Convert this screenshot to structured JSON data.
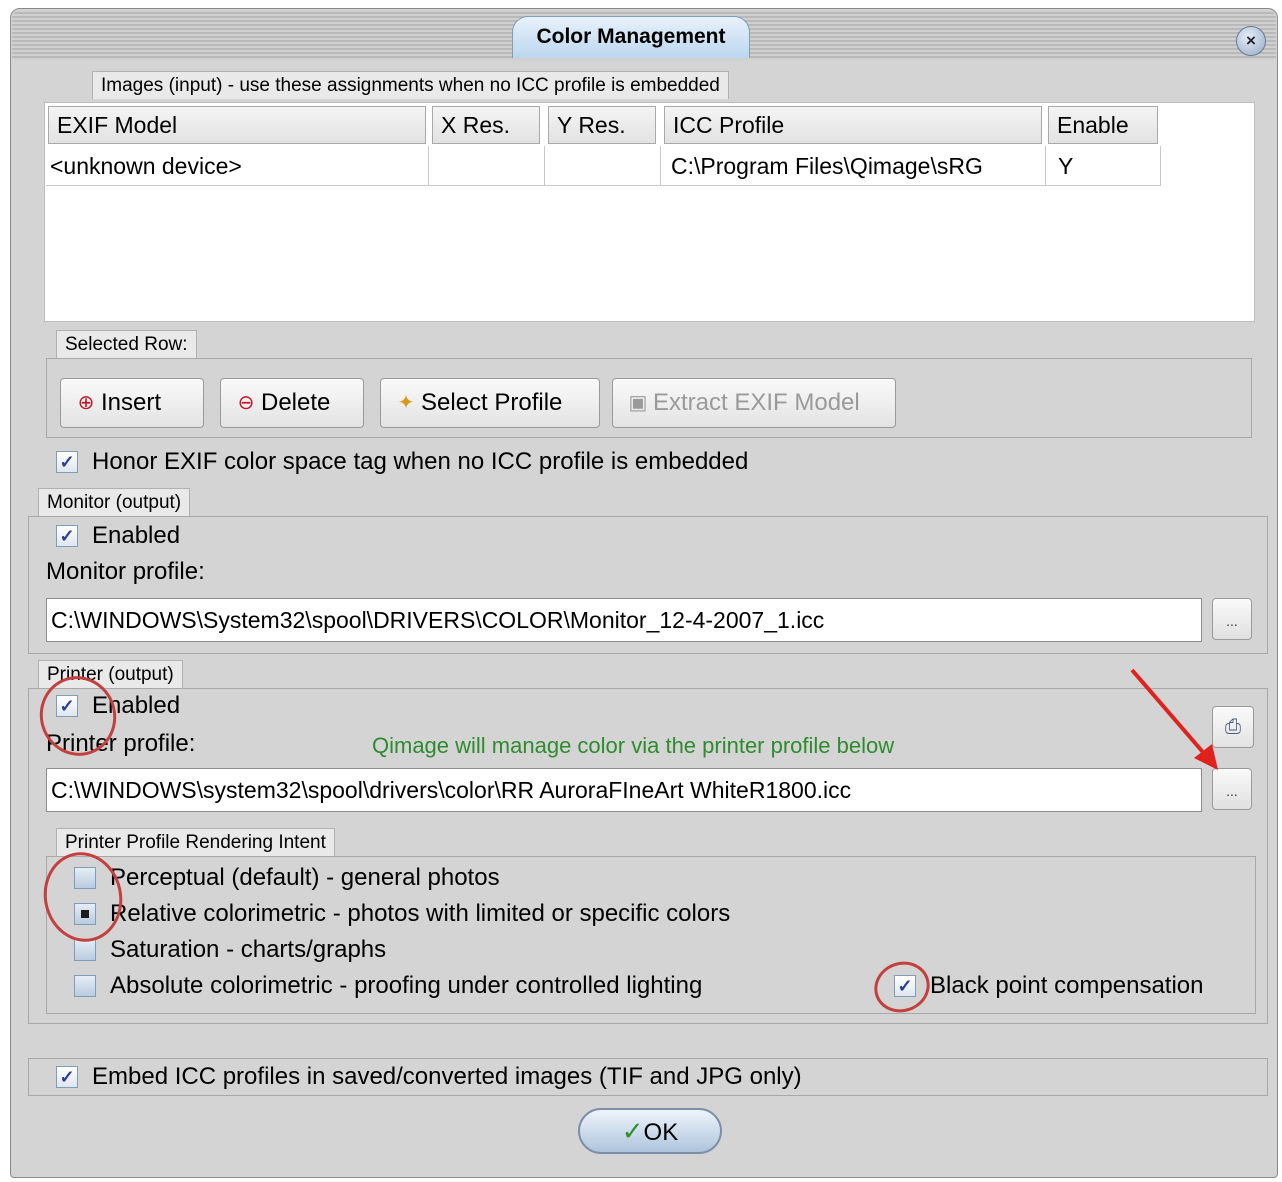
{
  "window": {
    "title": "Color Management",
    "close_glyph": "×"
  },
  "images_section": {
    "header": "Images (input) - use these assignments when no ICC profile is embedded",
    "columns": [
      "EXIF Model",
      "X Res.",
      "Y Res.",
      "ICC Profile",
      "Enable"
    ],
    "rows": [
      [
        "<unknown device>",
        "",
        "",
        "C:\\Program Files\\Qimage\\sRG",
        "Y"
      ]
    ],
    "selected_row_label": "Selected Row:",
    "buttons": {
      "insert": "Insert",
      "delete": "Delete",
      "select_profile": "Select Profile",
      "extract_exif": "Extract EXIF Model"
    },
    "honor_exif_label": "Honor EXIF color space tag when no ICC profile is embedded",
    "honor_exif_checked": true
  },
  "monitor_section": {
    "header": "Monitor (output)",
    "enabled_label": "Enabled",
    "enabled_checked": true,
    "profile_label": "Monitor profile:",
    "profile_value": "C:\\WINDOWS\\System32\\spool\\DRIVERS\\COLOR\\Monitor_12-4-2007_1.icc",
    "browse_label": "..."
  },
  "printer_section": {
    "header": "Printer (output)",
    "enabled_label": "Enabled",
    "enabled_checked": true,
    "profile_label": "Printer profile:",
    "annotation": "Qimage will manage color via the printer profile below",
    "annotation_color": "#2e8b2e",
    "profile_value": "C:\\WINDOWS\\system32\\spool\\drivers\\color\\RR AuroraFIneArt WhiteR1800.icc",
    "browse_label": "...",
    "printer_icon": "printer-icon"
  },
  "rendering_intent": {
    "header": "Printer Profile Rendering Intent",
    "options": [
      "Perceptual (default) - general photos",
      "Relative colorimetric - photos with limited or specific colors",
      "Saturation - charts/graphs",
      "Absolute colorimetric - proofing under controlled lighting"
    ],
    "selected": "Relative colorimetric - photos with limited or specific colors",
    "black_point_label": "Black point compensation",
    "black_point_checked": true
  },
  "embed": {
    "label": "Embed ICC profiles in saved/converted images (TIF and JPG only)",
    "checked": true
  },
  "ok_label": "OK",
  "annotation_color": "#c2413f"
}
